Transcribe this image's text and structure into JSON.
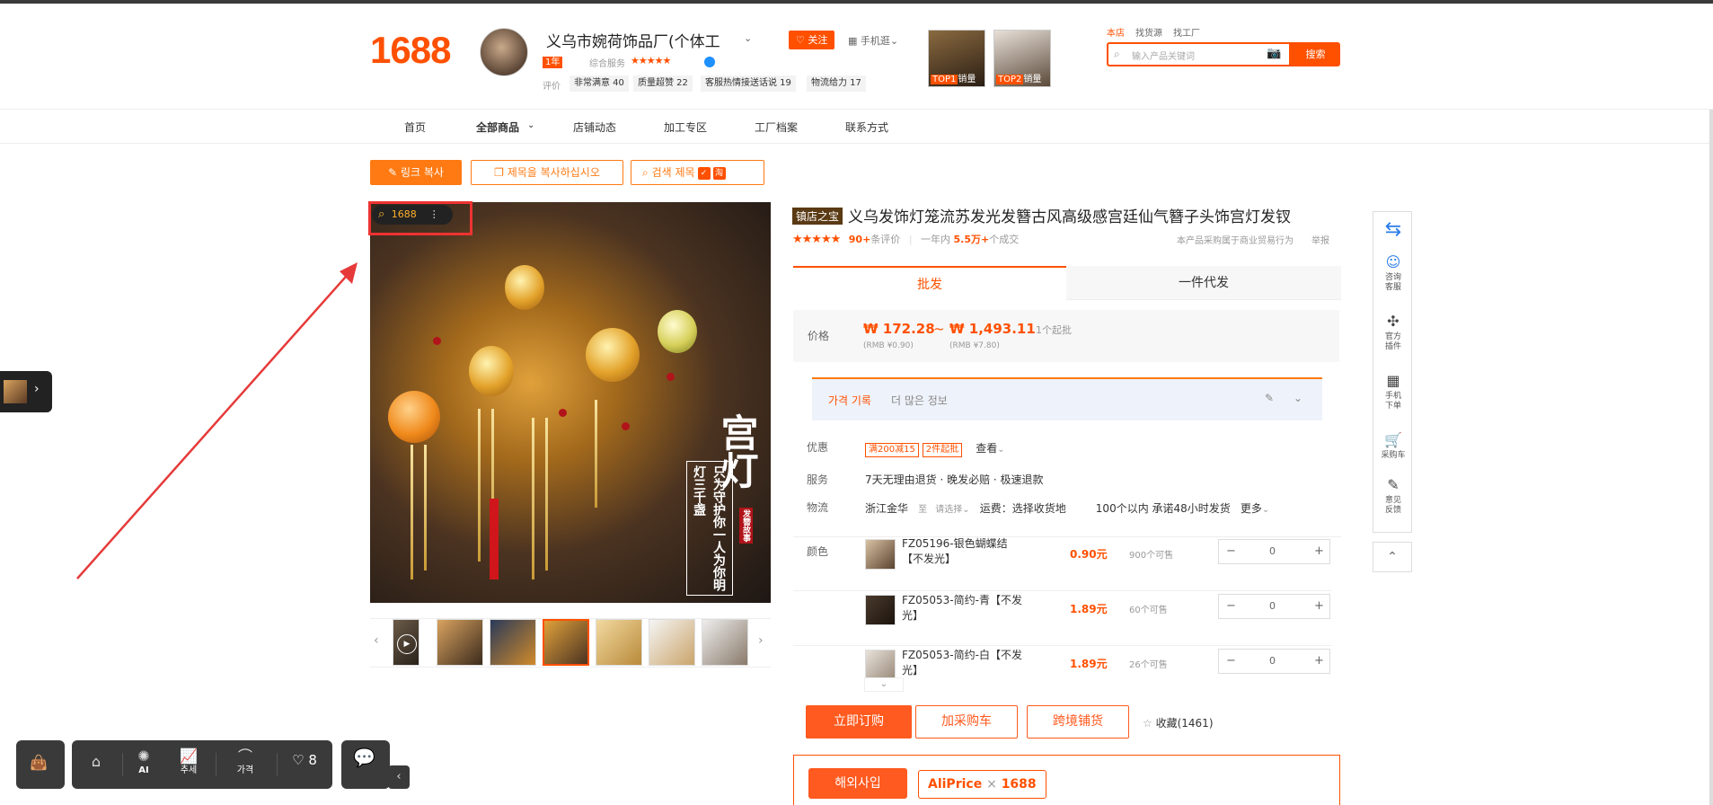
{
  "header": {
    "logo": "1688",
    "shop_name": "义乌市婉荷饰品厂(个体工",
    "follow": "关注",
    "mobile": "手机逛",
    "year_badge": "1年",
    "service_label": "综合服务",
    "stars": "★★★★★",
    "rating_label": "评价",
    "rating_tags": [
      "非常满意 40",
      "质量超赞 22",
      "客服热情接送话说 19",
      "物流给力 17"
    ],
    "top1_label": "TOP1",
    "top1_suffix": "销量",
    "top2_label": "TOP2",
    "top2_suffix": "销量",
    "search_tabs": [
      "本店",
      "找货源",
      "找工厂"
    ],
    "search_placeholder": "输入产品关键词",
    "search_button": "搜索"
  },
  "nav": {
    "items": [
      "首页",
      "全部商品",
      "店铺动态",
      "加工专区",
      "工厂档案",
      "联系方式"
    ]
  },
  "tools": {
    "link_copy": "링크 복사",
    "title_copy": "제목을 복사하십시오",
    "search_title": "검색 제목"
  },
  "overlay": {
    "label": "1688"
  },
  "image_text": {
    "big": "宫灯",
    "poem": "只为守护你一人为你明灯三千盏",
    "seal": "发簪故事"
  },
  "product": {
    "tag": "镇店之宝",
    "title": "义乌发饰灯笼流苏发光发簪古风高级感宫廷仙气簪子头饰宫灯发钗",
    "rating_stars": "★★★★★",
    "reviews_count": "90+",
    "reviews_label": "条评价",
    "sold_prefix": "一年内",
    "sold_count": "5.5万+",
    "sold_suffix": "个成交",
    "notice": "本产品采购属于商业贸易行为",
    "report": "举报"
  },
  "tabs": {
    "wholesale": "批发",
    "dropship": "一件代发"
  },
  "price": {
    "label": "价格",
    "low": "₩ 172.28",
    "sep": "~",
    "high": "₩ 1,493.11",
    "low_rmb": "(RMB ¥0.90)",
    "high_rmb": "(RMB ¥7.80)",
    "min_order": "1个起批"
  },
  "history": {
    "title": "가격 기록",
    "more": "더 많은 정보"
  },
  "promo": {
    "label": "优惠",
    "tag1": "满200减15",
    "tag2": "2件起批",
    "view": "查看"
  },
  "service": {
    "label": "服务",
    "value": "7天无理由退货 · 晚发必赔 · 极速退款"
  },
  "logistics": {
    "label": "物流",
    "origin": "浙江金华",
    "to": "至",
    "choose": "请选择",
    "fee": "运费：选择收货地",
    "promise": "100个以内 承诺48小时发货",
    "more": "更多"
  },
  "color_label": "颜色",
  "skus": [
    {
      "name": "FZ05196-银色蝴蝶结【不发光】",
      "price": "0.90元",
      "stock": "900个可售",
      "qty": "0"
    },
    {
      "name": "FZ05053-简约-青【不发光】",
      "price": "1.89元",
      "stock": "60个可售",
      "qty": "0"
    },
    {
      "name": "FZ05053-简约-白【不发光】",
      "price": "1.89元",
      "stock": "26个可售",
      "qty": "0"
    }
  ],
  "actions": {
    "buy": "立即订购",
    "add_cart": "加采购车",
    "cross_border": "跨境铺货",
    "favorite": "收藏(1461)"
  },
  "overseas": {
    "button": "해외사입",
    "aliprice": "AliPrice",
    "x": "×",
    "brand": "1688"
  },
  "sidepanel": {
    "items": [
      "咨询客服",
      "官方插件",
      "手机下单",
      "采购车",
      "意见反馈"
    ]
  },
  "dock": {
    "ai": "AI",
    "trend": "추세",
    "price": "가격",
    "fav_count": "8"
  },
  "colors": {
    "accent": "#ff5000",
    "highlight_box": "#ee3333"
  }
}
